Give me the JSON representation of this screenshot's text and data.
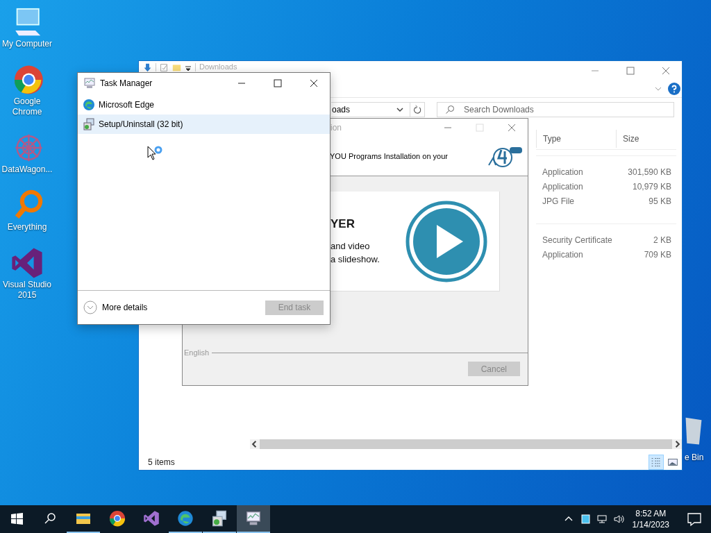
{
  "desktop_icons": [
    {
      "kind": "computer",
      "label": "My Computer"
    },
    {
      "kind": "chrome",
      "label": "Google Chrome"
    },
    {
      "kind": "datawagon",
      "label": "DataWagon..."
    },
    {
      "kind": "everything",
      "label": "Everything"
    },
    {
      "kind": "visualstudio",
      "label": "Visual Studio 2015"
    }
  ],
  "recycle_bin": {
    "label": "e Bin"
  },
  "explorer": {
    "title": "Downloads",
    "address": "oads",
    "search": {
      "placeholder": "Search Downloads"
    },
    "columns": [
      "Type",
      "Size"
    ],
    "groups": [
      [
        {
          "type": "Application",
          "size": "301,590 KB"
        },
        {
          "type": "Application",
          "size": "10,979 KB"
        },
        {
          "type": "JPG File",
          "size": "95 KB"
        }
      ],
      [
        {
          "type": "Security Certificate",
          "size": "2 KB"
        },
        {
          "type": "Application",
          "size": "709 KB"
        }
      ]
    ],
    "status": "5 items",
    "views": [
      {
        "kind": "details",
        "selected": true
      },
      {
        "kind": "thumbnails",
        "selected": false
      }
    ]
  },
  "installer": {
    "title": "ion",
    "header": "YOU Programs Installation on your",
    "banner_title": "YER",
    "banner_lines": [
      "and video",
      "a slideshow."
    ],
    "language": "English",
    "cancel": {
      "label": "Cancel",
      "disabled": true
    }
  },
  "task_manager": {
    "title": "Task Manager",
    "apps": [
      {
        "kind": "edge",
        "label": "Microsoft Edge",
        "selected": false
      },
      {
        "kind": "setup",
        "label": "Setup/Uninstall (32 bit)",
        "selected": true
      }
    ],
    "more_details": "More details",
    "end_task": {
      "label": "End task",
      "disabled": true
    }
  },
  "taskbar": {
    "apps": [
      {
        "kind": "explorer",
        "running": true,
        "selected": false
      },
      {
        "kind": "chrome",
        "running": false,
        "selected": false
      },
      {
        "kind": "visualstudio",
        "running": false,
        "selected": false
      },
      {
        "kind": "edge",
        "running": true,
        "selected": false
      },
      {
        "kind": "setup",
        "running": true,
        "selected": false
      },
      {
        "kind": "taskmanager",
        "running": true,
        "selected": true
      }
    ],
    "time": "8:52 AM",
    "date": "1/14/2023"
  }
}
